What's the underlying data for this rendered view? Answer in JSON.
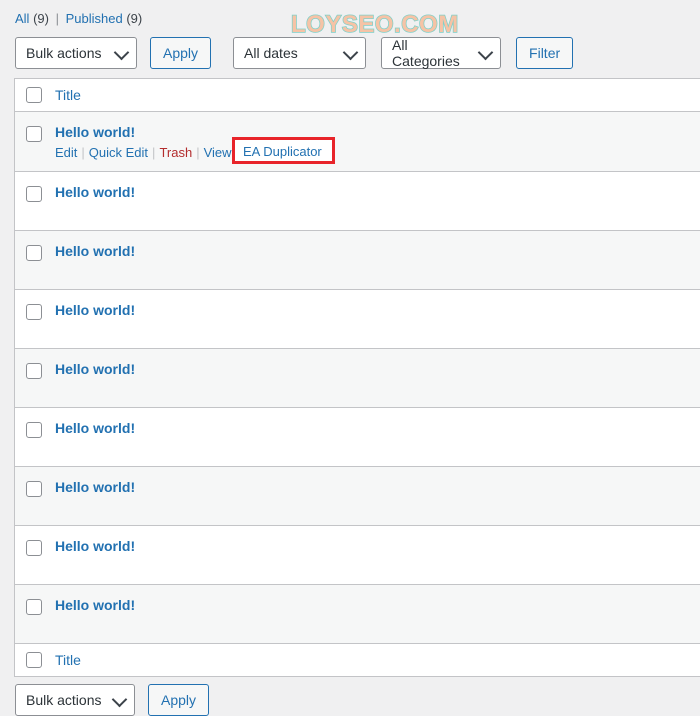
{
  "watermark": {
    "text": "LOYSEO.COM"
  },
  "status_links": {
    "all_label": "All",
    "all_count": "(9)",
    "separator": "|",
    "published_label": "Published",
    "published_count": "(9)"
  },
  "toolbar": {
    "bulk_actions_value": "Bulk actions",
    "apply_label": "Apply",
    "dates_value": "All dates",
    "categories_value": "All Categories",
    "filter_label": "Filter"
  },
  "table": {
    "header_title": "Title",
    "footer_title": "Title",
    "rows": [
      {
        "title": "Hello world!",
        "actions": {
          "edit": "Edit",
          "quick_edit": "Quick Edit",
          "trash": "Trash",
          "view": "View",
          "duplicator": "EA Duplicator"
        }
      },
      {
        "title": "Hello world!"
      },
      {
        "title": "Hello world!"
      },
      {
        "title": "Hello world!"
      },
      {
        "title": "Hello world!"
      },
      {
        "title": "Hello world!"
      },
      {
        "title": "Hello world!"
      },
      {
        "title": "Hello world!"
      },
      {
        "title": "Hello world!"
      }
    ]
  },
  "bottom_toolbar": {
    "bulk_actions_value": "Bulk actions",
    "apply_label": "Apply"
  },
  "colors": {
    "link": "#2271b1",
    "trash": "#b32d2e",
    "highlight_box": "#e8242a",
    "page_background": "#f0f0f1",
    "row_alt_background": "#f6f7f7",
    "watermark_fill": "#f6c3a6",
    "watermark_stroke": "#7fd0c8"
  }
}
